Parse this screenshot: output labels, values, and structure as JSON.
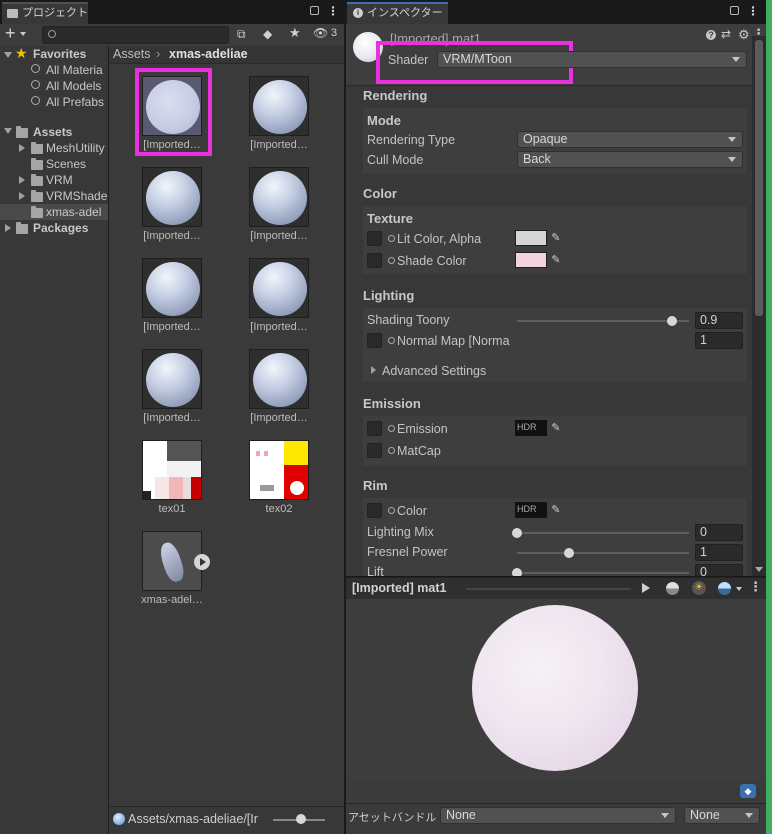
{
  "project_panel": {
    "tab_title": "プロジェクト",
    "hidden_count": "3",
    "breadcrumb": {
      "root": "Assets",
      "current": "xmas-adeliae"
    },
    "tree": {
      "favorites_label": "Favorites",
      "favorites": [
        "All Materia",
        "All Models",
        "All Prefabs"
      ],
      "assets_label": "Assets",
      "folders": [
        "MeshUtility",
        "Scenes",
        "VRM",
        "VRMShade",
        "xmas-adel"
      ],
      "packages_label": "Packages"
    },
    "assets": [
      {
        "label": "[Imported…",
        "kind": "material"
      },
      {
        "label": "[Imported…",
        "kind": "material"
      },
      {
        "label": "[Imported…",
        "kind": "material"
      },
      {
        "label": "[Imported…",
        "kind": "material"
      },
      {
        "label": "[Imported…",
        "kind": "material"
      },
      {
        "label": "[Imported…",
        "kind": "material"
      },
      {
        "label": "[Imported…",
        "kind": "material"
      },
      {
        "label": "[Imported…",
        "kind": "material"
      },
      {
        "label": "tex01",
        "kind": "texture"
      },
      {
        "label": "tex02",
        "kind": "texture"
      },
      {
        "label": "xmas-adel…",
        "kind": "model"
      }
    ],
    "status_path": "Assets/xmas-adeliae/[Ir"
  },
  "inspector": {
    "tab_title": "インスペクター",
    "material_name": "[Imported] mat1",
    "shader_label": "Shader",
    "shader_value": "VRM/MToon",
    "rendering": {
      "header": "Rendering",
      "mode_label": "Mode",
      "rendering_type_label": "Rendering Type",
      "rendering_type_value": "Opaque",
      "cull_mode_label": "Cull Mode",
      "cull_mode_value": "Back"
    },
    "color": {
      "header": "Color",
      "texture_label": "Texture",
      "lit_color_label": "Lit Color, Alpha",
      "shade_color_label": "Shade Color",
      "lit_swatch": "#d6d6d6",
      "shade_swatch": "#f3d3e0"
    },
    "lighting": {
      "header": "Lighting",
      "shading_toony_label": "Shading Toony",
      "shading_toony_value": "0.9",
      "shading_toony_level": 0.9,
      "normal_map_label": "Normal Map [Norma",
      "normal_map_value": "1",
      "advanced_label": "Advanced Settings"
    },
    "emission": {
      "header": "Emission",
      "emission_label": "Emission",
      "hdr_label": "HDR",
      "matcap_label": "MatCap"
    },
    "rim": {
      "header": "Rim",
      "color_label": "Color",
      "hdr_label": "HDR",
      "lighting_mix_label": "Lighting Mix",
      "lighting_mix_value": "0",
      "lighting_mix_level": 0,
      "fresnel_label": "Fresnel Power",
      "fresnel_value": "1",
      "fresnel_level": 0.3,
      "lift_label": "Lift",
      "lift_value": "0",
      "lift_level": 0
    },
    "preview_title": "[Imported] mat1",
    "assetbundle_label": "アセットバンドル",
    "assetbundle_value": "None",
    "assetbundle_variant": "None"
  },
  "colors": {
    "highlight": "#e832e0",
    "accent_tab": "#3a72b0"
  }
}
